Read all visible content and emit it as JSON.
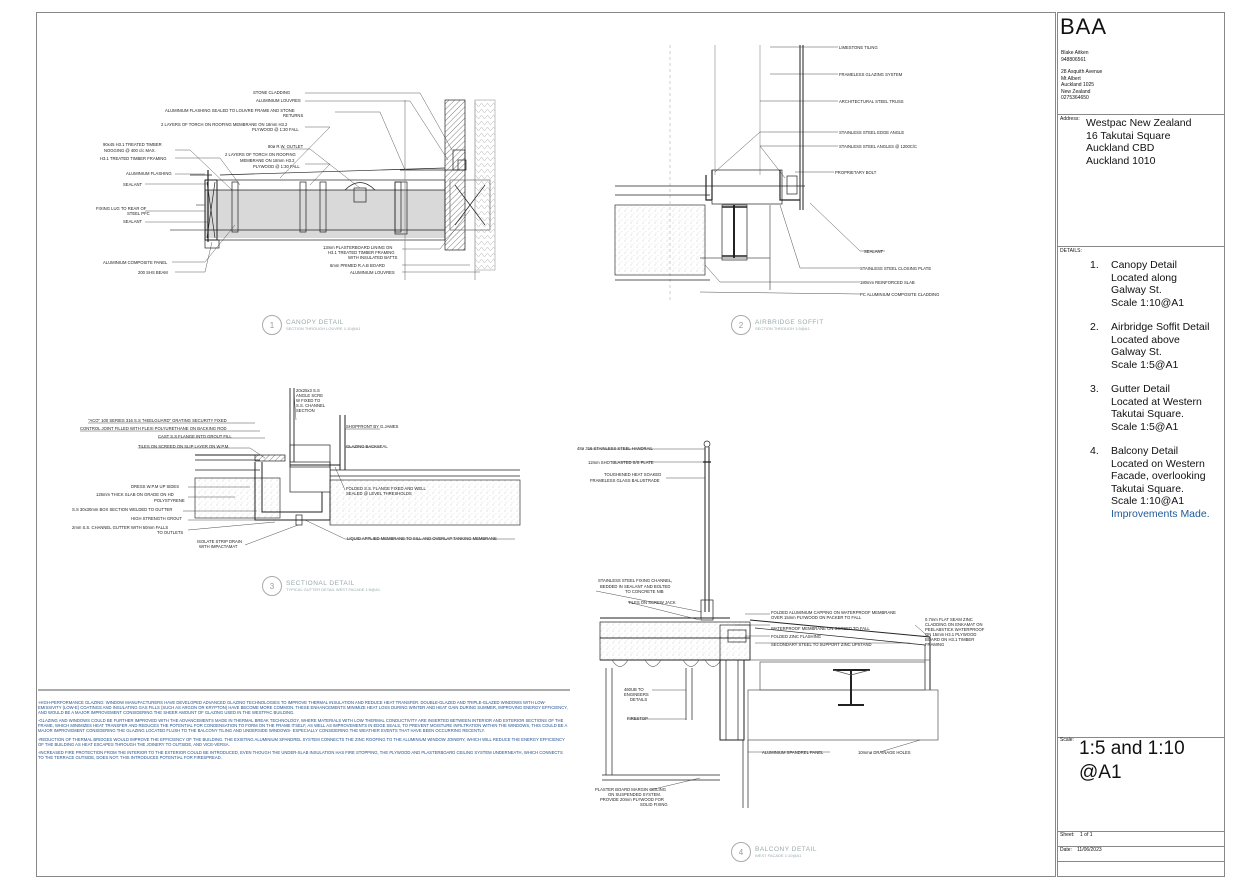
{
  "title_block": {
    "logo": "BAA",
    "author": "Blake Aitken",
    "student_id": "948806561",
    "address_lines": [
      "28 Asquith Avenue",
      "Mt Albert",
      "Auckland 1025",
      "New Zealand",
      "0275364650"
    ],
    "address_label": "Address:",
    "project_address": [
      "Westpac New Zealand",
      "16 Takutai Square",
      "Auckland CBD",
      "Auckland 1010"
    ],
    "details_label": "DETAILS:",
    "details": [
      {
        "num": "1.",
        "lines": [
          "Canopy Detail",
          "Located along",
          "Galway St.",
          "Scale 1:10@A1"
        ]
      },
      {
        "num": "2.",
        "lines": [
          "Airbridge Soffit Detail",
          "Located above",
          "Galway St.",
          "Scale 1:5@A1"
        ]
      },
      {
        "num": "3.",
        "lines": [
          "Gutter Detail",
          "Located at Western",
          "Takutai Square.",
          "Scale 1:5@A1"
        ]
      },
      {
        "num": "4.",
        "lines": [
          "Balcony Detail",
          "Located on Western",
          "Facade, overlooking",
          "Takutai Square.",
          "Scale 1:10@A1"
        ],
        "extra": "Improvements Made."
      }
    ],
    "scale_label": "Scale:",
    "scale_value_1": "1:5 and 1:10",
    "scale_value_2": "@A1",
    "sheet_label": "Sheet:",
    "sheet_value": "1 of 1",
    "date_label": "Date:",
    "date_value": "11/06/2023"
  },
  "captions": [
    {
      "num": "1",
      "title": "CANOPY DETAIL",
      "sub": "SECTION THROUGH LOUVRE 1:10@A1"
    },
    {
      "num": "2",
      "title": "AIRBRIDGE SOFFIT",
      "sub": "SECTION THROUGH 1:5@A1"
    },
    {
      "num": "3",
      "title": "SECTIONAL DETAIL",
      "sub": "TYPICAL GUTTER DETAIL WEST FACADE 1:5@A1"
    },
    {
      "num": "4",
      "title": "BALCONY DETAIL",
      "sub": "WEST FACADE 1:10@A1"
    }
  ],
  "canopy_labels": [
    "STONE CLADDING",
    "ALUMINIUM LOUVRES",
    "ALUMINIUM FLASHING SEALED TO LOUVRE FRAME AND STONE",
    "RETURNS",
    "2 LAYERS OF TORCH ON ROOFING MEMBRANE ON 18mm H3.2",
    "PLYWOOD @ 1:30 FALL",
    "90x45 H3.1 TREATED TIMBER",
    "NOGGING @ 400 c/c MAX.",
    "H3.1 TREATED TIMBER FRAMING",
    "80ø R.W. OUTLET",
    "2 LAYERS OF TORCH ON ROOFING",
    "MEMBRANE ON 18mm H3.2",
    "PLYWOOD @ 1:30 FALL",
    "ALUMINIUM FLASHING",
    "SEALANT",
    "FIXING LUG TO REAR OF",
    "STEEL PFC",
    "SEALANT",
    "13mm PLASTERBOARD LINING ON",
    "H3.1 TREATED TIMBER FRAMING",
    "WITH INSULATED BATTS",
    "6mm PRIMED R.A.B BOARD",
    "ALUMINIUM LOUVRES",
    "ALUMINIUM COMPOSITE PANEL",
    "200 SHS BEAM"
  ],
  "airbridge_labels": [
    "LIMESTONE TILING",
    "FRAMELESS GLAZING SYSTEM",
    "ARCHITECTURAL STEEL TRUSS",
    "STAINLESS STEEL EDGE ANGLE",
    "STAINLESS STEEL ANGLES @ 1200C/C",
    "PROPRIETARY BOLT",
    "SEALANT",
    "STAINLESS STEEL CLOSING PLATE",
    "180mm REINFORCED SLAB",
    "PC ALUMINIUM COMPOSITE CLADDING"
  ],
  "gutter_labels": [
    "20x25x3 S.S",
    "ANGLE SCRE",
    "W FIXED TO",
    "S.S. CHANNEL",
    "SECTION",
    "\"ACO\" 100 SERIES 316 S.S \"HEELGUARD\" GRATING SECURITY FIXED",
    "CONTROL JOINT FILLED WITH FLEXI POLYURETHANE ON BACKING ROD",
    "CAST S.S FLANGE INTO GROUT FILL",
    "TILES ON SCREED ON SLIP LAYER ON W.P.M.",
    "SHOPFRONT BY G.JAMES",
    "GLAZING BACKSEAL",
    "DRESS W.P.M UP SIDES",
    "125mm THICK SLAB ON GRADE ON HD",
    "POLYSTYRENE",
    "FOLDED S.S. FLANGE FIXED AND WELL",
    "SEALED @ LEVEL THRESHOLDS",
    "S.S 30x30mm BOX SECTION WELDED TO GUTTER",
    "HIGH STRENGTH GROUT",
    "2mm S.S. CHANNEL GUTTER WITH 50mm FALLS",
    "TO OUTLETS",
    "ISOLATE STRIP DRAIN",
    "WITH IMPACTAMAT",
    "LIQUID APPLIED MEMBRANE TO SILL AND OVERLAP TANKING MEMBRANE"
  ],
  "balcony_labels": [
    "48ø 316 STAINLESS STEEL HANDRAIL",
    "12mm SHOTBLASTED S/S PLATE",
    "TOUGHENED HEAT SOAKED",
    "FRAMELESS GLASS BALUSTRADE",
    "STAINLESS STEEL FIXING CHANNEL,",
    "BEDDED IN SEALANT AND BOLTED",
    "TO CONCRETE NIB",
    "TILES ON SCREW JACK",
    "FOLDED ALUMINIUM CAPPING ON WATERPROOF MEMBRANE",
    "OVER 15mm PLYWOOD ON PACKER TO FALL",
    "WATERPROOF MEMBRANE ON SCREED TO FALL",
    "FOLDED ZINC FLASHING",
    "SECONDARY STEEL TO SUPPORT ZINC UPSTAND",
    "0.7mm FLAT SEAM ZINC",
    "CLADDING ON ENKAMAT ON",
    "PEELABSTICK WATERPROOF",
    "ON 15mm H3.1 PLYWOOD",
    "BOARD ON H3.1 TIMBER",
    "FRAMING",
    "460UB TO",
    "ENGINEERS",
    "DETAILS",
    "FIRESTOP",
    "ALUMINIUM SPANDREL PANEL",
    "10mmø DRAINAGE HOLES",
    "PLASTER BOARD MARGIN CEILING",
    "ON SUSPENDED SYSTEM.",
    "PROVIDE 20mm PLYWOOD FOR",
    "SOLID FIXING"
  ],
  "notes": [
    "-HIGH-PERFORMANCE GLAZING: WINDOW MANUFACTURERS HAVE DEVELOPED ADVANCED GLAZING TECHNOLOGIES TO IMPROVE THERMAL INSULATION AND REDUCE HEAT TRANSFER. DOUBLE-GLAZED AND TRIPLE-GLAZED WINDOWS WITH LOW-EMISSIVITY (LOW-E) COATINGS AND INSULATING GAS FILLS (SUCH AS ARGON OR KRYPTON) HAVE BECOME MORE COMMON. THESE ENHANCEMENTS MINIMIZE HEAT LOSS DURING WINTER AND HEAT GAIN DURING SUMMER, IMPROVING ENERGY EFFICIENCY, AND WOULD BE A MAJOR IMPROVEMENT CONSIDERING THE SHEER AMOUNT OF GLAZING USED IN THE WESTPAC BUILDING.",
    "-GLAZING AND WINDOWS COULD BE FURTHER IMPROVED WITH THE ADVANCEMENTS MADE IN THERMAL BREAK TECHNOLOGY, WHERE MATERIALS WITH LOW THERMAL CONDUCTIVITY ARE INSERTED BETWEEN INTERIOR AND EXTERIOR SECTIONS OF THE FRAME, WHICH MINIMIZES HEAT TRANSFER AND REDUCES THE POTENTIAL FOR CONDENSATION TO FORM ON THE FRAME ITSELF, AS WELL AS IMPROVEMENTS IN EDGE SEALS, TO PREVENT MOISTURE INFILTRATION WITHIN THE WINDOWS, THIS COULD BE A MAJOR IMPROVEMENT CONSIDERING THE GLAZING LOCATED FLUSH TO THE BALCONY TILING AND UNDERSIDE WINDOWS- ESPECIALLY CONSIDERING THE WEATHER EVENTS THAT HAVE BEEN OCCURRING RECENTLY.",
    "-REDUCTION OF THERMAL BRIDGES WOULD IMPROVE THE EFFICIENCY OF THE BUILDING. THE EXISTING ALUMINIUM SPANDREL SYSTEM CONNECTS THE ZINC ROOFING TO THE ALUMINIUM WINDOW JOINERY, WHICH WILL REDUCE THE ENERGY EFFICIENCY OF THE BUILDING AS HEAT ESCAPES THROUGH THE JOINERY TO OUTSIDE, AND VICE-VERSA.",
    "-INCREASED FIRE PROTECTION FROM THE INTERIOR TO THE EXTERIOR COULD BE INTRODUCED, EVEN THOUGH THE UNDER-SLAB INSULATION HAS FIRE STOPPING, THE PLYWOOD AND PLASTERBOARD CEILING SYSTEM UNDERNEATH, WHICH CONNECTS TO THE TERRACE OUTSIDE, DOES NOT. THIS INTRODUCES POTENTIAL FOR FIRESPREAD."
  ]
}
